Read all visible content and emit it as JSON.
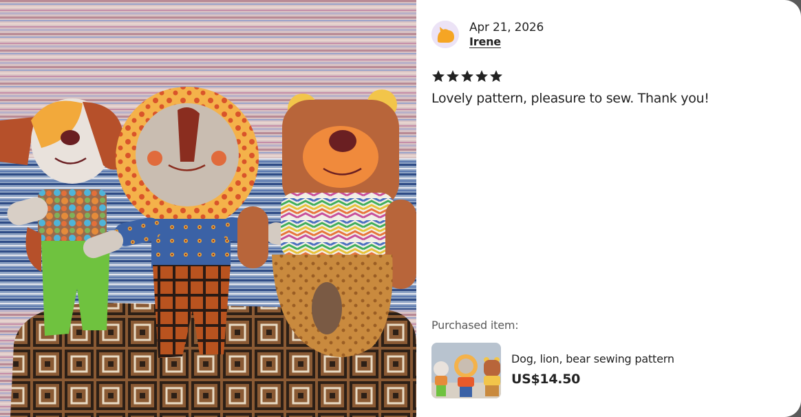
{
  "review": {
    "date": "Apr 21, 2026",
    "reviewer": "Irene",
    "rating": 5,
    "rating_max": 5,
    "text": "Lovely pattern, pleasure to sew. Thank you!"
  },
  "purchased": {
    "label": "Purchased item:",
    "title": "Dog, lion, bear sewing pattern",
    "price": "US$14.50"
  },
  "icons": {
    "avatar": "cat-avatar-icon",
    "star": "star-icon"
  },
  "colors": {
    "star": "#222222",
    "avatar_bg": "#ece3f6",
    "avatar_fg": "#f5a524",
    "text": "#222222",
    "muted": "#595959"
  }
}
